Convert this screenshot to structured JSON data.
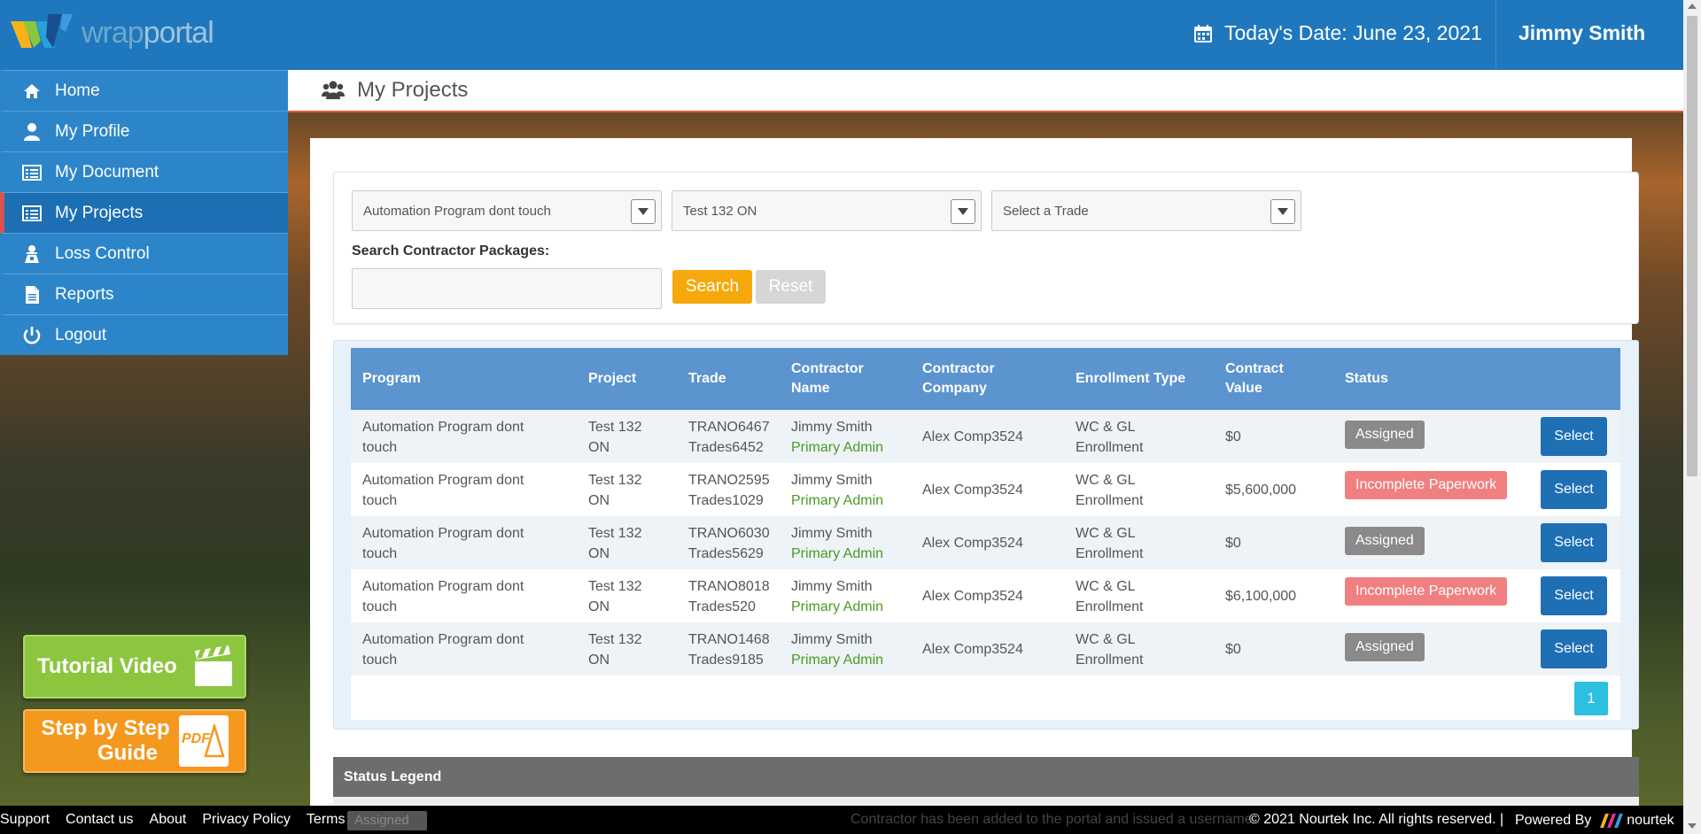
{
  "header": {
    "logo_text_a": "wrap",
    "logo_text_b": "portal",
    "today_label": "Today's Date: June 23, 2021",
    "user": "Jimmy Smith"
  },
  "sidebar": {
    "items": [
      {
        "label": "Home",
        "icon": "home-icon"
      },
      {
        "label": "My Profile",
        "icon": "user-icon"
      },
      {
        "label": "My Document",
        "icon": "document-list-icon"
      },
      {
        "label": "My Projects",
        "icon": "projects-list-icon",
        "active": true
      },
      {
        "label": "Loss Control",
        "icon": "loss-control-icon"
      },
      {
        "label": "Reports",
        "icon": "report-file-icon"
      },
      {
        "label": "Logout",
        "icon": "power-icon"
      }
    ],
    "tutorial_label": "Tutorial Video",
    "guide_label_1": "Step by Step",
    "guide_label_2": "Guide",
    "guide_badge": "PDF"
  },
  "page": {
    "title": "My Projects"
  },
  "filters": {
    "program_value": "Automation Program dont touch",
    "project_value": "Test 132 ON",
    "trade_placeholder": "Select a Trade",
    "search_label": "Search Contractor Packages:",
    "search_button": "Search",
    "reset_button": "Reset"
  },
  "table": {
    "headers": {
      "program": "Program",
      "project": "Project",
      "trade": "Trade",
      "contractor_name_1": "Contractor",
      "contractor_name_2": "Name",
      "contractor_company_1": "Contractor",
      "contractor_company_2": "Company",
      "enrollment": "Enrollment Type",
      "value_1": "Contract",
      "value_2": "Value",
      "status": "Status"
    },
    "rows": [
      {
        "program_1": "Automation Program dont",
        "program_2": "touch",
        "project_1": "Test 132",
        "project_2": "ON",
        "trade_1": "TRANO6467",
        "trade_2": "Trades6452",
        "name": "Jimmy Smith",
        "role": "Primary Admin",
        "company": "Alex Comp3524",
        "enroll_1": "WC & GL",
        "enroll_2": "Enrollment",
        "value": "$0",
        "status": "Assigned",
        "action": "Select"
      },
      {
        "program_1": "Automation Program dont",
        "program_2": "touch",
        "project_1": "Test 132",
        "project_2": "ON",
        "trade_1": "TRANO2595",
        "trade_2": "Trades1029",
        "name": "Jimmy Smith",
        "role": "Primary Admin",
        "company": "Alex Comp3524",
        "enroll_1": "WC & GL",
        "enroll_2": "Enrollment",
        "value": "$5,600,000",
        "status": "Incomplete Paperwork",
        "action": "Select"
      },
      {
        "program_1": "Automation Program dont",
        "program_2": "touch",
        "project_1": "Test 132",
        "project_2": "ON",
        "trade_1": "TRANO6030",
        "trade_2": "Trades5629",
        "name": "Jimmy Smith",
        "role": "Primary Admin",
        "company": "Alex Comp3524",
        "enroll_1": "WC & GL",
        "enroll_2": "Enrollment",
        "value": "$0",
        "status": "Assigned",
        "action": "Select"
      },
      {
        "program_1": "Automation Program dont",
        "program_2": "touch",
        "project_1": "Test 132",
        "project_2": "ON",
        "trade_1": "TRANO8018",
        "trade_2": "Trades520",
        "name": "Jimmy Smith",
        "role": "Primary Admin",
        "company": "Alex Comp3524",
        "enroll_1": "WC & GL",
        "enroll_2": "Enrollment",
        "value": "$6,100,000",
        "status": "Incomplete Paperwork",
        "action": "Select"
      },
      {
        "program_1": "Automation Program dont",
        "program_2": "touch",
        "project_1": "Test 132",
        "project_2": "ON",
        "trade_1": "TRANO1468",
        "trade_2": "Trades9185",
        "name": "Jimmy Smith",
        "role": "Primary Admin",
        "company": "Alex Comp3524",
        "enroll_1": "WC & GL",
        "enroll_2": "Enrollment",
        "value": "$0",
        "status": "Assigned",
        "action": "Select"
      }
    ],
    "page": "1"
  },
  "legend": {
    "title": "Status Legend",
    "partial_badge": "Assigned",
    "partial_text": "Contractor has been added to the portal and issued a username"
  },
  "footer": {
    "links": [
      "Support",
      "Contact us",
      "About",
      "Privacy Policy",
      "Terms of use"
    ],
    "copyright": "© 2021 Nourtek Inc. All rights reserved. |",
    "powered": "Powered By",
    "brand": "nourtek"
  },
  "colors": {
    "header_blue": "#1f78bd",
    "assigned_grey": "#8a8a8a",
    "incomplete_red": "#f08080",
    "select_blue": "#1f6fb5",
    "search_orange": "#f5a90c"
  }
}
